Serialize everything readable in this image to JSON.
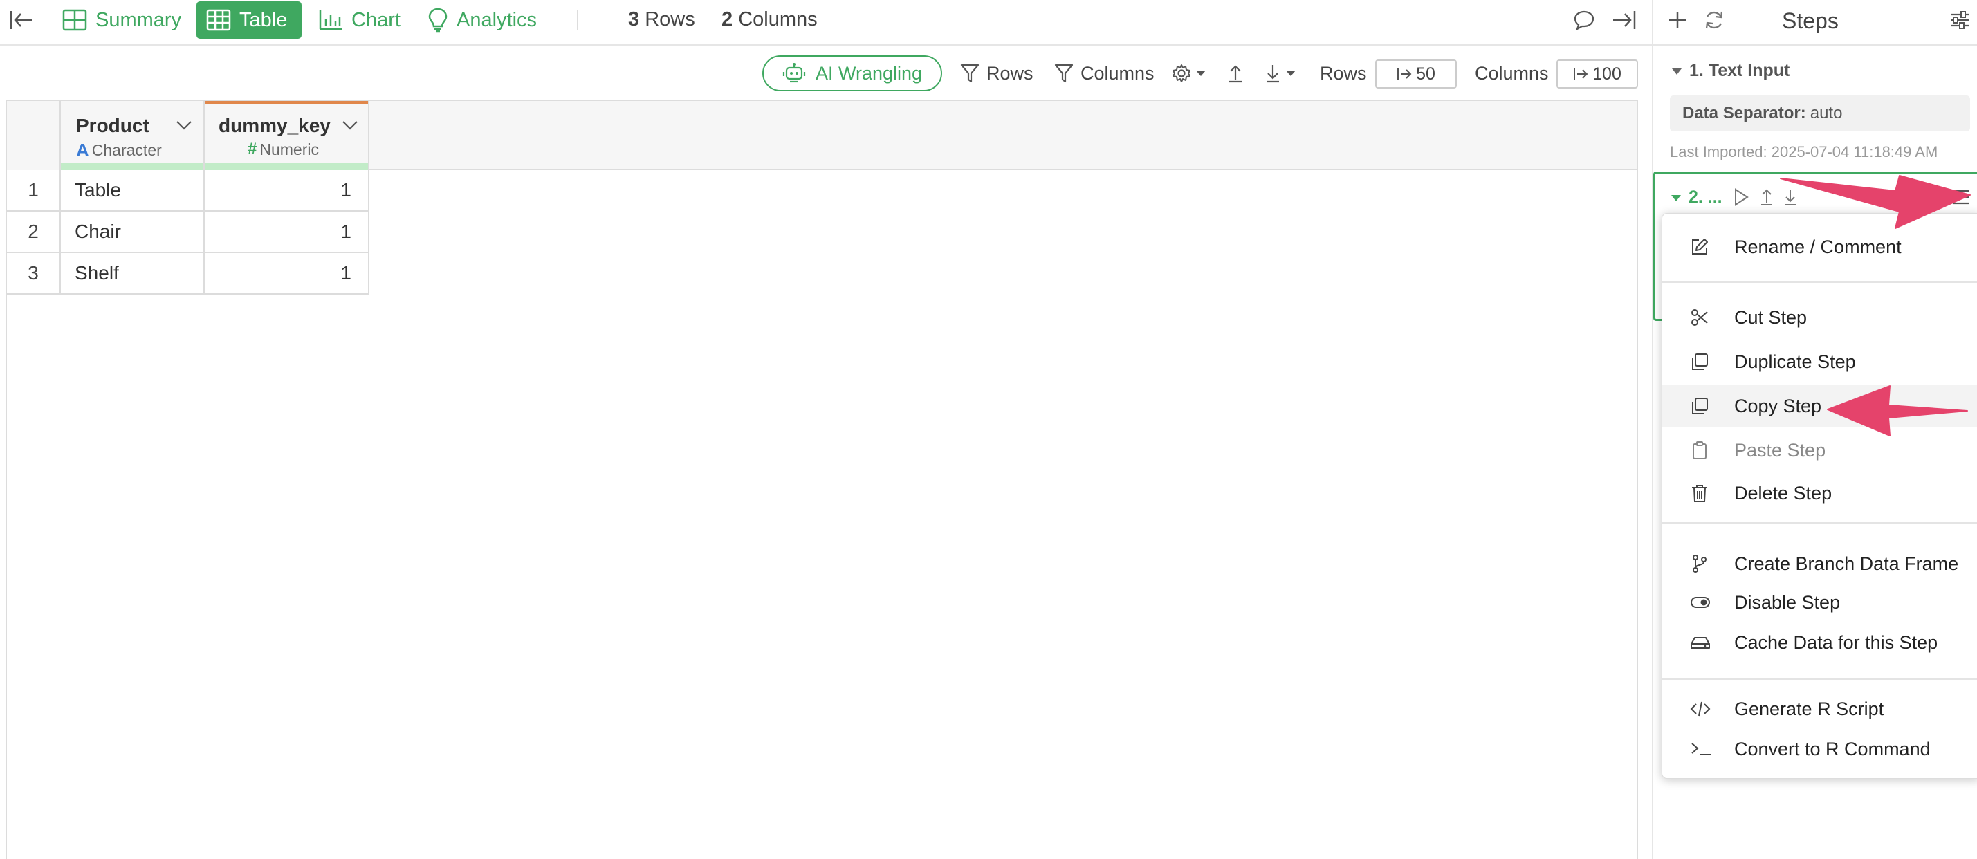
{
  "nav": {
    "tabs": [
      {
        "label": "Summary",
        "icon": "grid-icon"
      },
      {
        "label": "Table",
        "icon": "table-icon",
        "active": true
      },
      {
        "label": "Chart",
        "icon": "bar-chart-icon"
      },
      {
        "label": "Analytics",
        "icon": "lightbulb-icon"
      }
    ],
    "rows_count": "3",
    "rows_label": "Rows",
    "cols_count": "2",
    "cols_label": "Columns"
  },
  "toolbar": {
    "ai_label": "AI Wrangling",
    "rows_filter_label": "Rows",
    "cols_filter_label": "Columns",
    "rows_limit_label": "Rows",
    "rows_limit_value": "50",
    "cols_limit_label": "Columns",
    "cols_limit_value": "100"
  },
  "table": {
    "columns": [
      {
        "name": "Product",
        "type_icon": "A",
        "type": "Character"
      },
      {
        "name": "dummy_key",
        "type_icon": "#",
        "type": "Numeric"
      }
    ],
    "rows": [
      {
        "n": "1",
        "product": "Table",
        "key": "1"
      },
      {
        "n": "2",
        "product": "Chair",
        "key": "1"
      },
      {
        "n": "3",
        "product": "Shelf",
        "key": "1"
      }
    ]
  },
  "steps": {
    "title": "Steps",
    "step1_title": "1. Text Input",
    "separator_label": "Data Separator:",
    "separator_value": "auto",
    "last_imported": "Last Imported: 2025-07-04 11:18:49 AM",
    "step2_title": "2. ..."
  },
  "menu": {
    "items": [
      {
        "label": "Rename / Comment",
        "icon": "edit-icon"
      },
      {
        "label": "Cut Step",
        "icon": "scissors-icon"
      },
      {
        "label": "Duplicate Step",
        "icon": "duplicate-icon"
      },
      {
        "label": "Copy Step",
        "icon": "copy-icon"
      },
      {
        "label": "Paste Step",
        "icon": "clipboard-icon"
      },
      {
        "label": "Delete Step",
        "icon": "trash-icon"
      },
      {
        "label": "Create Branch Data Frame",
        "icon": "branch-icon"
      },
      {
        "label": "Disable Step",
        "icon": "toggle-icon"
      },
      {
        "label": "Cache Data for this Step",
        "icon": "drive-icon"
      },
      {
        "label": "Generate R Script",
        "icon": "code-icon"
      },
      {
        "label": "Convert to R Command",
        "icon": "terminal-icon"
      }
    ]
  },
  "colors": {
    "accent": "#3fa860",
    "arrow": "#e5436b",
    "column_type_bar": "#c2ecc8",
    "dummy_key_top": "#e0874b"
  }
}
